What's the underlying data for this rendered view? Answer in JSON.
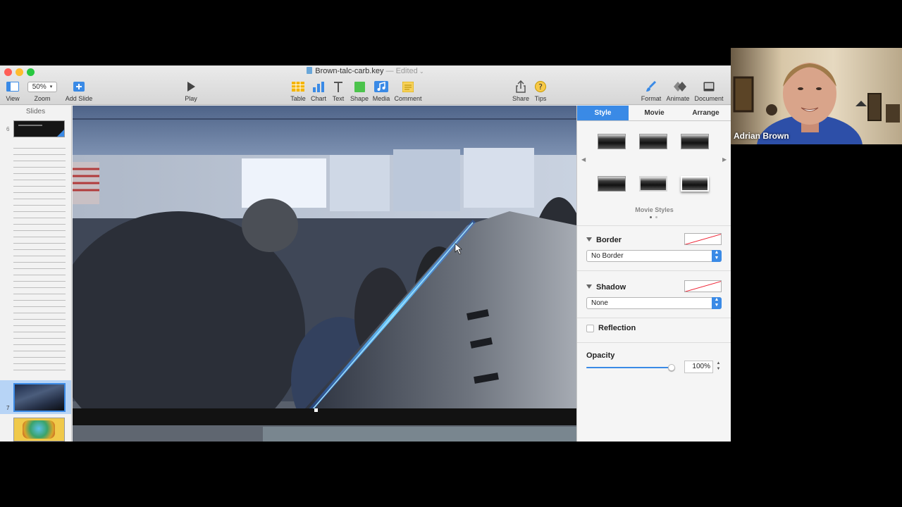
{
  "window": {
    "title": "Brown-talc-carb.key",
    "status": "— Edited",
    "traffic_colors": [
      "#ff5f57",
      "#febc2e",
      "#28c840"
    ]
  },
  "toolbar": {
    "view": "View",
    "zoom_value": "50%",
    "zoom": "Zoom",
    "add_slide": "Add Slide",
    "play": "Play",
    "table": "Table",
    "chart": "Chart",
    "text": "Text",
    "shape": "Shape",
    "media": "Media",
    "comment": "Comment",
    "share": "Share",
    "tips": "Tips",
    "format": "Format",
    "animate": "Animate",
    "document": "Document"
  },
  "slides_panel": {
    "header": "Slides",
    "slide_6_number": "6",
    "slide_7_number": "7"
  },
  "inspector": {
    "tabs": [
      "Style",
      "Movie",
      "Arrange"
    ],
    "active_tab": "Style",
    "movie_styles_label": "Movie Styles",
    "border": {
      "title": "Border",
      "value": "No Border"
    },
    "shadow": {
      "title": "Shadow",
      "value": "None"
    },
    "reflection": {
      "title": "Reflection",
      "checked": false
    },
    "opacity": {
      "title": "Opacity",
      "value": "100%",
      "level": 1.0
    }
  },
  "webcam": {
    "participant_name": "Adrian Brown"
  },
  "colors": {
    "accent": "#3a8ae6"
  }
}
